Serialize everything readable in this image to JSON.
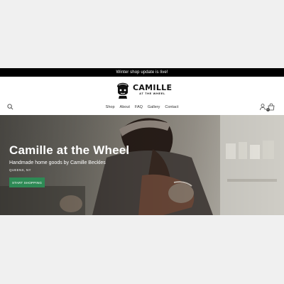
{
  "announcement": "Winter shop update is live!",
  "logo": {
    "name": "CAMILLE",
    "tagline": "AT THE WHEEL"
  },
  "nav": {
    "items": [
      "Shop",
      "About",
      "FAQ",
      "Gallery",
      "Contact"
    ]
  },
  "cart": {
    "count": "0"
  },
  "hero": {
    "title": "Camille at the Wheel",
    "subtitle": "Handmade home goods by Camille Beckles",
    "location": "QUEENS, NY",
    "cta_label": "START SHOPPING"
  },
  "colors": {
    "announcement_bg": "#000000",
    "cta_green": "#2e8a55",
    "header_bg": "#ffffff"
  }
}
